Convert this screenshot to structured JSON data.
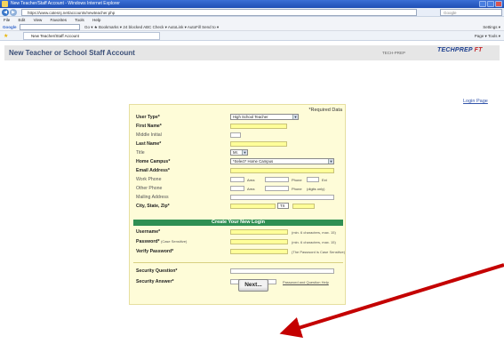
{
  "browser": {
    "window_title": "New Teacher/Staff Account - Windows Internet Explorer",
    "url": "https://www.catesnj.net/accounts/newteacher.php",
    "search_placeholder": "Google",
    "menu": [
      "File",
      "Edit",
      "View",
      "Favorites",
      "Tools",
      "Help"
    ],
    "google_bar": {
      "logo": "Google",
      "items": "Go ▾ ★ Bookmarks ▾  24 blocked  ABC Check ▾  AutoLink ▾  AutoFill  Send to ▾",
      "settings": "Settings ▾"
    },
    "tab_title": "New Teacher/Staff Account",
    "tab_tools": "Page ▾  Tools ▾"
  },
  "header": {
    "title": "New Teacher or School Staff Account",
    "right_text": "TECH-PREP",
    "logo_main": "TECHPREP",
    "logo_accent": "FT"
  },
  "login_link": "Login Page",
  "form": {
    "required_note": "*Required Data",
    "user_type": {
      "label": "User Type*",
      "value": "High School Teacher"
    },
    "first_name": "First Name*",
    "middle_initial": "Middle Initial",
    "last_name": "Last Name*",
    "title": {
      "label": "Title",
      "value": "Mr."
    },
    "home_campus": {
      "label": "Home Campus*",
      "value": "*Select* Home Campus"
    },
    "email": "Email Address*",
    "work_phone": {
      "label": "Work Phone",
      "area": "Area",
      "phone": "Phone",
      "ext": "Ext"
    },
    "other_phone": {
      "label": "Other Phone",
      "area": "Area",
      "phone": "Phone",
      "digits": "(digits only)"
    },
    "mailing_address": "Mailing Address",
    "city_state_zip": {
      "label": "City, State, Zip*",
      "state": "TX"
    },
    "login_section": "Create Your New Login",
    "username": {
      "label": "Username*",
      "hint": "(min. 6 characters, max. 15)"
    },
    "password": {
      "label": "Password*",
      "sub": "(Case Sensitive)",
      "hint": "(min. 6 characters, max. 15)"
    },
    "verify_password": {
      "label": "Verify Password*",
      "hint": "(The Password is Case Sensitive)"
    },
    "security_question": "Security Question*",
    "security_answer": {
      "label": "Security Answer*",
      "hint": "Password and Question Help"
    }
  },
  "next_button": "Next...",
  "colors": {
    "form_bg": "#fefcd8",
    "section_green": "#2f8f53",
    "arrow_red": "#c40000",
    "title_blue": "#3b4f77"
  }
}
